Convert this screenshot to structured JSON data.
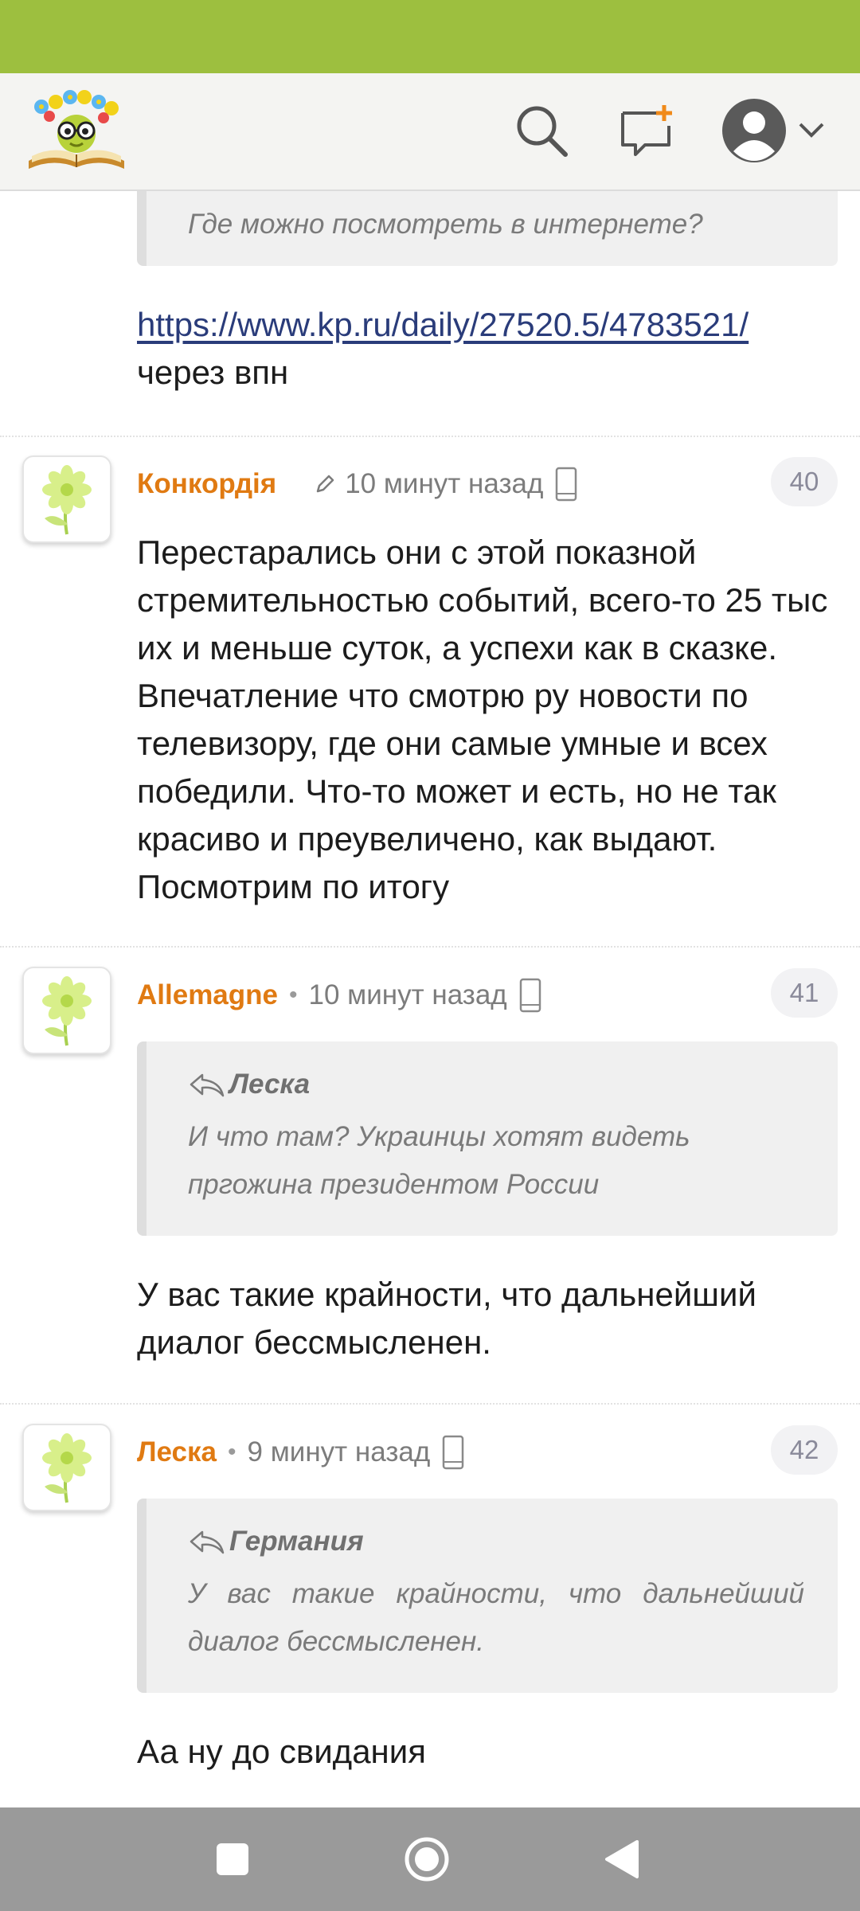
{
  "colors": {
    "status_bar": "#9dbf3f",
    "author": "#e07a12",
    "link": "#2a3c7a",
    "nav_bar": "#9a9a9a"
  },
  "header": {
    "logo": "site-logo",
    "icons": [
      "search-icon",
      "new-message-icon",
      "user-avatar-icon",
      "chevron-down-icon"
    ]
  },
  "top_fragment": {
    "quote_text": "Где можно посмотреть в интернете?",
    "link": "https://www.kp.ru/daily/27520.5/4783521/",
    "text": "через впн"
  },
  "comments": [
    {
      "author": "Конкордія",
      "time": "10 минут назад",
      "number": "40",
      "text": "Перестарались они с этой показной стремительностью событий, всего-то 25 тыс их и меньше суток, а успехи как в сказке. Впечатление что смотрю ру новости по телевизору, где они самые умные и всех победили. Что-то может и есть, но не так красиво и преувеличено, как выдают. Посмотрим по итогу"
    },
    {
      "author": "Allemagne",
      "time": "10 минут назад",
      "number": "41",
      "quote_author": "Леска",
      "quote_text": "И что там? Украинцы хотят видеть пргожина президентом России",
      "text": "У вас такие крайности, что дальнейший диалог бессмысленен."
    },
    {
      "author": "Леска",
      "time": "9 минут назад",
      "number": "42",
      "quote_author": "Германия",
      "quote_text": "У вас такие крайности, что дальнейший диалог бессмысленен.",
      "text": "Аа ну до свидания"
    }
  ],
  "nav": {
    "icons": [
      "recents-square-icon",
      "home-circle-icon",
      "back-triangle-icon"
    ]
  }
}
